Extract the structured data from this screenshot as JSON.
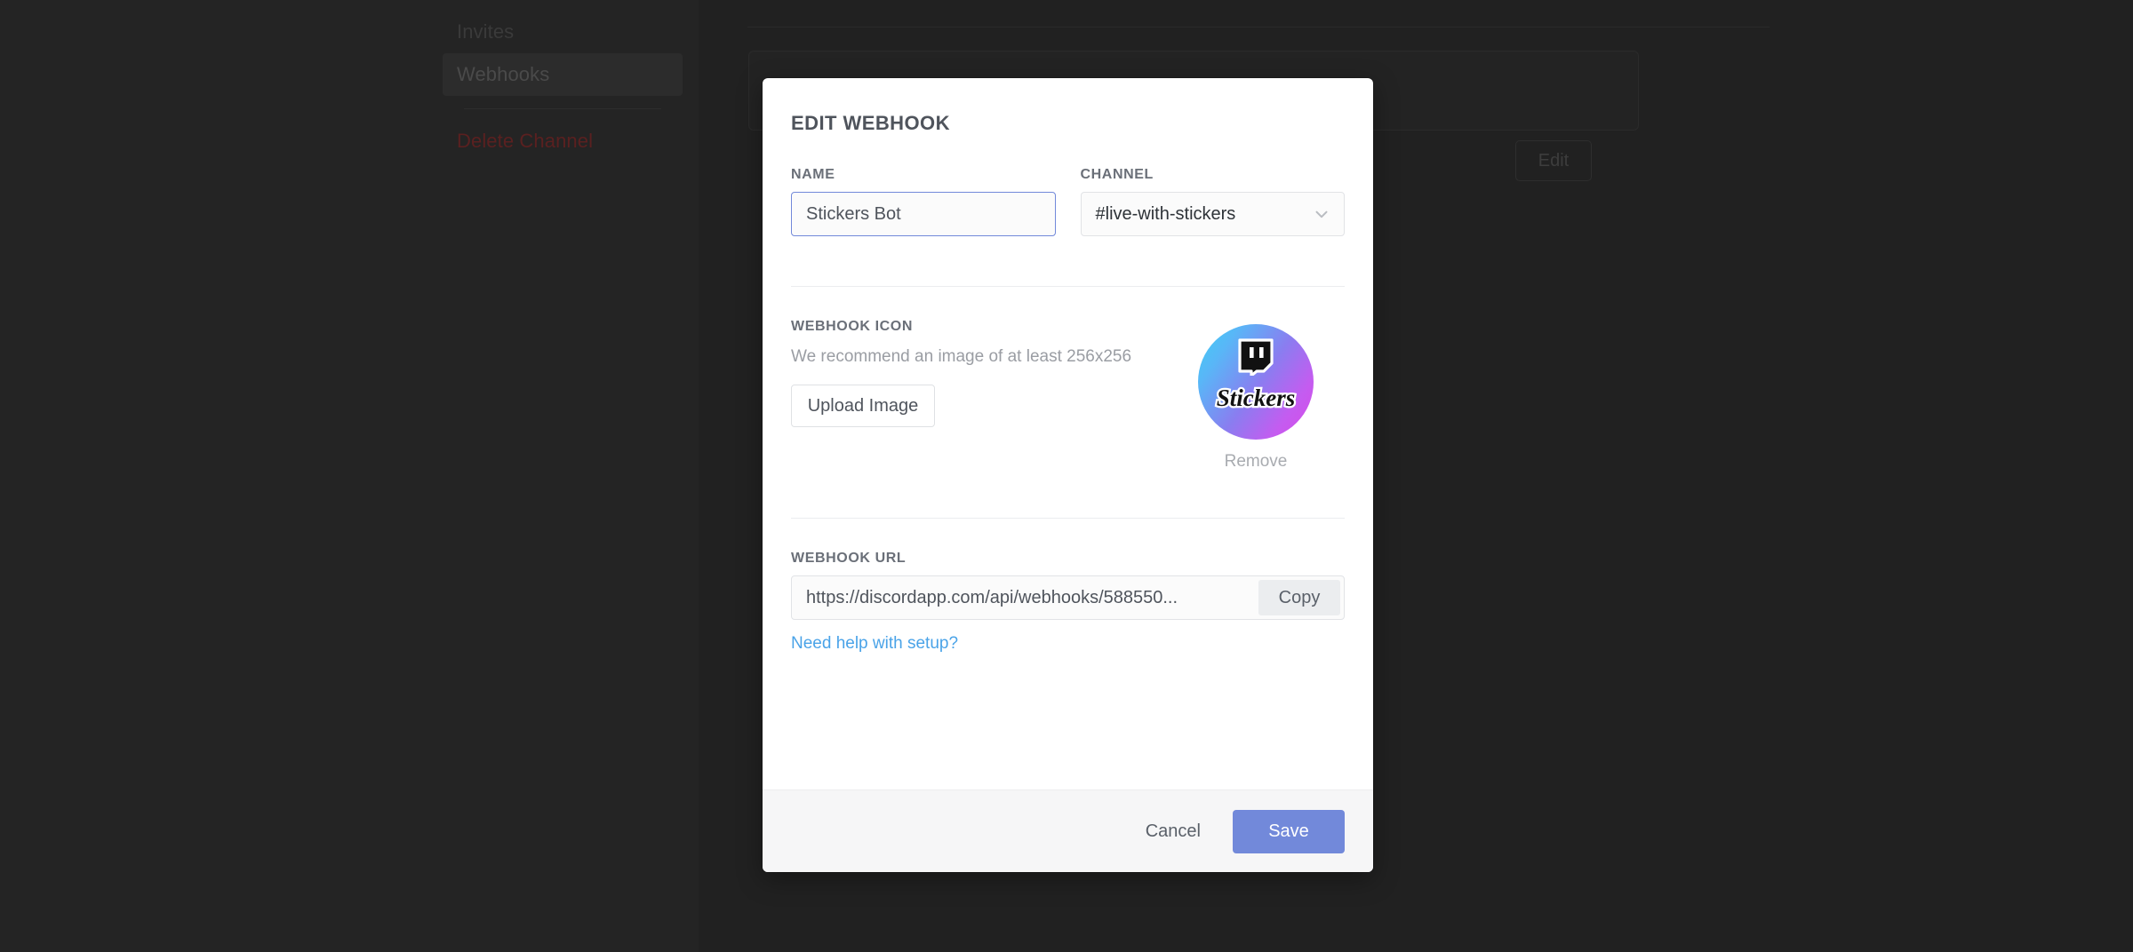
{
  "background": {
    "sidebar": {
      "items": [
        {
          "label": "Invites",
          "active": false,
          "danger": false
        },
        {
          "label": "Webhooks",
          "active": true,
          "danger": false
        },
        {
          "label": "Delete Channel",
          "active": false,
          "danger": true
        }
      ]
    },
    "edit_button_label": "Edit"
  },
  "modal": {
    "title": "EDIT WEBHOOK",
    "name": {
      "label": "NAME",
      "value": "Stickers Bot",
      "placeholder": "Enter a name"
    },
    "channel": {
      "label": "CHANNEL",
      "value": "#live-with-stickers",
      "chevron_icon": "chevron-down-icon"
    },
    "icon_section": {
      "label": "WEBHOOK ICON",
      "hint": "We recommend an image of at least 256x256",
      "upload_label": "Upload Image",
      "remove_label": "Remove",
      "avatar": {
        "logo_icon": "twitch-glitch-icon",
        "word": "Stickers",
        "gradient_from": "#3fd0f5",
        "gradient_to": "#d84ae8"
      }
    },
    "url_section": {
      "label": "WEBHOOK URL",
      "value": "https://discordapp.com/api/webhooks/588550...",
      "copy_label": "Copy",
      "help_label": "Need help with setup?"
    },
    "footer": {
      "cancel_label": "Cancel",
      "save_label": "Save"
    }
  },
  "colors": {
    "accent": "#7289da",
    "link": "#4aa3e8",
    "danger": "#5a2020",
    "footer_bg": "#f6f6f7"
  }
}
